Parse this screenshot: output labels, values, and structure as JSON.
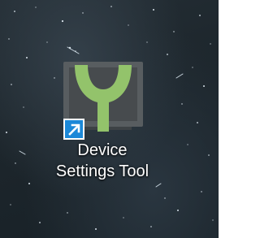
{
  "desktop_icon": {
    "name_line1": "Device",
    "name_line2": "Settings Tool",
    "app_icon": "tuning-fork-monitor-icon",
    "overlay_icon": "shortcut-arrow-icon",
    "colors": {
      "icon_green": "#93c36b",
      "monitor_frame": "#585d60",
      "monitor_screen": "#474b4e",
      "shortcut_badge": "#1b88d8",
      "label_text": "#ffffff",
      "background": "#1e272d"
    }
  }
}
